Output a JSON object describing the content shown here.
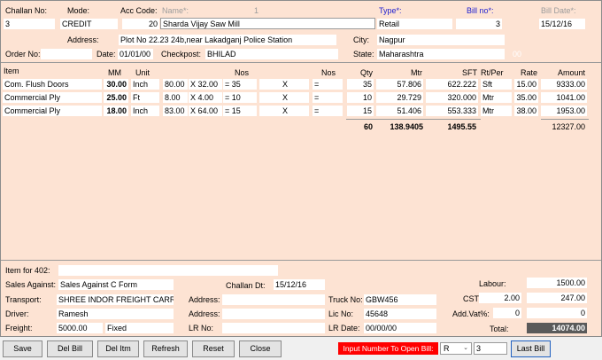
{
  "header": {
    "challan_no_label": "Challan No:",
    "challan_no": "3",
    "mode_label": "Mode:",
    "mode": "CREDIT",
    "acc_code_label": "Acc Code:",
    "acc_code": "20",
    "name_label": "Name*:",
    "name_hint": "1",
    "name": "Sharda Vijay Saw Mill",
    "type_label": "Type*:",
    "type": "Retail",
    "bill_no_label": "Bill no*:",
    "bill_no": "3",
    "bill_date_label": "Bill Date*:",
    "bill_date": "15/12/16",
    "address_label": "Address:",
    "address": "Plot No 22.23 24b,near Lakadganj Police Station",
    "city_label": "City:",
    "city": "Nagpur",
    "order_no_label": "Order No:",
    "order_no": "",
    "date_label": "Date:",
    "date": "01/01/00",
    "checkpost_label": "Checkpost:",
    "checkpost": "BHILAD",
    "state_label": "State:",
    "state": "Maharashtra",
    "state_code": "00"
  },
  "grid": {
    "columns": [
      "Item",
      "MM",
      "Unit",
      "Nos",
      "Nos",
      "Qty",
      "Mtr",
      "SFT",
      "Rt/Per",
      "Rate",
      "Amount"
    ],
    "rows": [
      {
        "item": "Com. Flush Doors",
        "mm": "30.00",
        "unit": "Inch",
        "d1": "80.00",
        "d2": "X 32.00",
        "nos": "= 35",
        "x": "X",
        "eq": "=",
        "qty": "35",
        "mtr": "57.806",
        "sft": "622.222",
        "rtper": "Sft",
        "rate": "15.00",
        "amount": "9333.00"
      },
      {
        "item": "Commercial Ply",
        "mm": "25.00",
        "unit": "Ft",
        "d1": "8.00",
        "d2": "X 4.00",
        "nos": "= 10",
        "x": "X",
        "eq": "=",
        "qty": "10",
        "mtr": "29.729",
        "sft": "320.000",
        "rtper": "Mtr",
        "rate": "35.00",
        "amount": "1041.00"
      },
      {
        "item": "Commercial Ply",
        "mm": "18.00",
        "unit": "Inch",
        "d1": "83.00",
        "d2": "X 64.00",
        "nos": "= 15",
        "x": "X",
        "eq": "=",
        "qty": "15",
        "mtr": "51.406",
        "sft": "553.333",
        "rtper": "Mtr",
        "rate": "38.00",
        "amount": "1953.00"
      }
    ],
    "totals": {
      "qty": "60",
      "mtr": "138.9405",
      "sft": "1495.55",
      "amount": "12327.00"
    }
  },
  "footer": {
    "item_for_402_label": "Item for 402:",
    "item_for_402": "",
    "sales_against_label": "Sales Against:",
    "sales_against": "Sales Against C Form",
    "challan_dt_label": "Challan Dt:",
    "challan_dt": "15/12/16",
    "transport_label": "Transport:",
    "transport": "SHREE INDOR FREIGHT CARR",
    "address1_label": "Address:",
    "address1": "",
    "truck_no_label": "Truck No:",
    "truck_no": "GBW456",
    "driver_label": "Driver:",
    "driver": "Ramesh",
    "address2_label": "Address:",
    "address2": "",
    "lic_no_label": "Lic No:",
    "lic_no": "45648",
    "freight_label": "Freight:",
    "freight": "5000.00",
    "freight_type": "Fixed",
    "lr_no_label": "LR No:",
    "lr_no": "",
    "lr_date_label": "LR Date:",
    "lr_date": "00/00/00",
    "labour_label": "Labour:",
    "labour": "1500.00",
    "cst_label": "CST",
    "cst_rate": "2.00",
    "cst": "247.00",
    "add_vat_label": "Add.Vat%:",
    "add_vat_rate": "0",
    "add_vat": "0",
    "total_label": "Total:",
    "total": "14074.00"
  },
  "toolbar": {
    "save": "Save",
    "del_bill": "Del Bill",
    "del_item": "Del Itm",
    "refresh": "Refresh",
    "reset": "Reset",
    "close": "Close",
    "open_bill_label": "Input Number To Open Bill:",
    "series": "R",
    "bill_number": "3",
    "last_bill": "Last Bill"
  }
}
